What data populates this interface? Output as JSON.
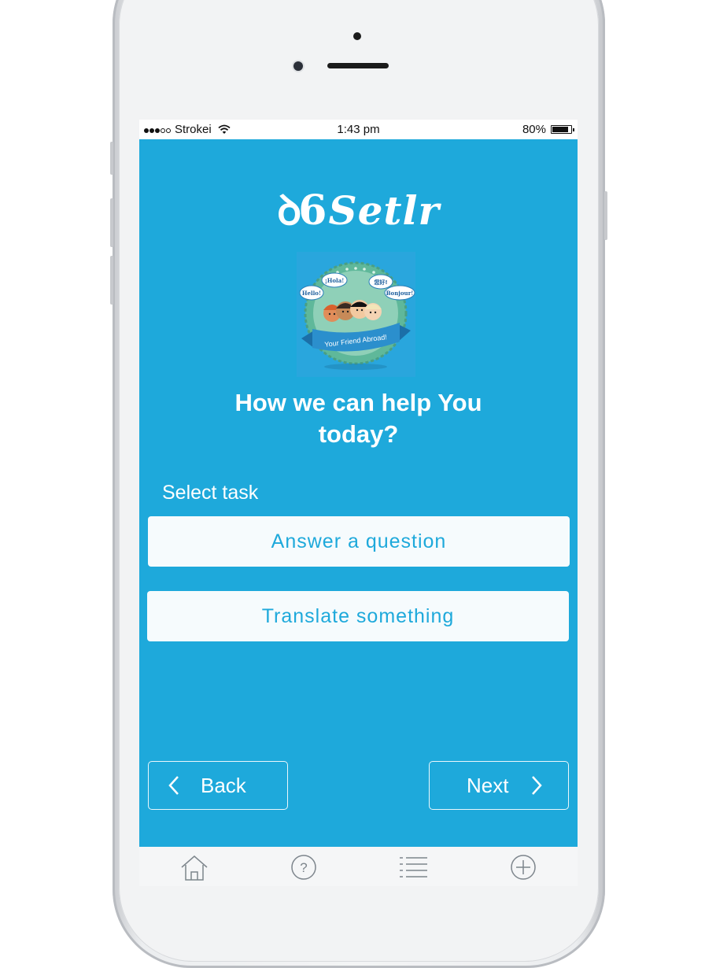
{
  "status_bar": {
    "carrier": "Strokei",
    "time": "1:43 pm",
    "battery": "80%",
    "signal_bars": 3,
    "signal_max": 5
  },
  "app": {
    "logo_text": "Setlr",
    "badge": {
      "bubbles": [
        "Hello!",
        "¡Hola!",
        "您好!",
        "Bonjour!"
      ],
      "ribbon": "Your Friend Abroad!"
    },
    "headline": "How we can help You today?",
    "select_label": "Select task",
    "tasks": [
      "Answer a question",
      "Translate something"
    ],
    "back_label": "Back",
    "next_label": "Next"
  },
  "tab_bar": {
    "items": [
      "home-icon",
      "help-icon",
      "list-icon",
      "add-icon"
    ]
  },
  "colors": {
    "accent": "#1ea9db",
    "button_bg": "#f6fbfd",
    "badge_green": "#5fb89a"
  }
}
